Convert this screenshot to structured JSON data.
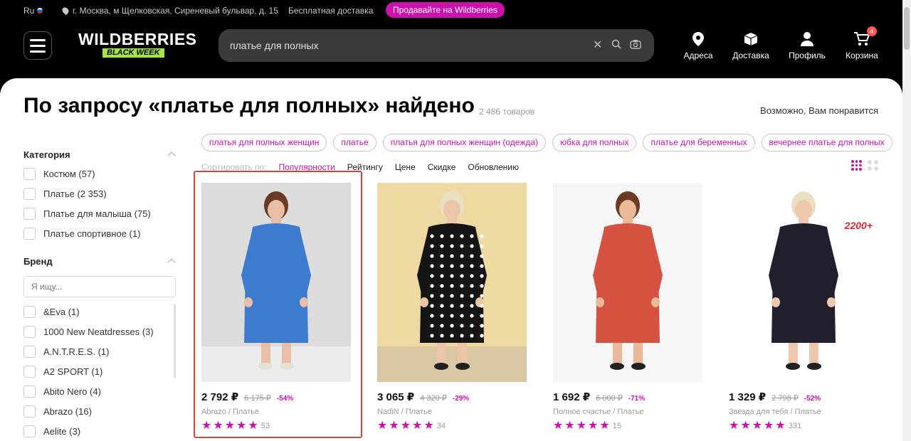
{
  "topbar": {
    "lang": "Ru",
    "address": "г. Москва, м Щелковская, Сиреневый бульвар, д. 15",
    "free_delivery": "Бесплатная доставка",
    "sell_button": "Продавайте на Wildberries"
  },
  "header": {
    "logo_text": "WILDBERRIES",
    "logo_badge": "BLACK WEEK",
    "search_value": "платье для полных",
    "nav": {
      "addresses": "Адреса",
      "delivery": "Доставка",
      "profile": "Профиль",
      "cart": "Корзина",
      "cart_count": "4"
    }
  },
  "results": {
    "title": "По запросу «платье для полных» найдено",
    "count": "2 486 товаров",
    "maybe_like": "Возможно, Вам понравится"
  },
  "sidebar": {
    "category_title": "Категория",
    "categories": [
      "Костюм (57)",
      "Платье (2 353)",
      "Платье для малыша (75)",
      "Платье спортивное (1)"
    ],
    "brand_title": "Бренд",
    "brand_placeholder": "Я ищу...",
    "brands": [
      "&Eva (1)",
      "1000 New Neatdresses (3)",
      "A.N.T.R.E.S. (1)",
      "A2 SPORT (1)",
      "Abito Nero (4)",
      "Abrazo (16)",
      "Aelite (3)"
    ]
  },
  "chips": [
    "платья для полных женщин",
    "платье",
    "платья для полных женщин (одежда)",
    "юбка для полных",
    "платье для беременных",
    "вечернее платье для полных"
  ],
  "sort": {
    "label": "Сортировать по:",
    "options": [
      "Популярности",
      "Рейтингу",
      "Цене",
      "Скидке",
      "Обновлению"
    ],
    "active": "Популярности"
  },
  "products": [
    {
      "price": "2 792 ₽",
      "old_price": "6 175 ₽",
      "discount": "-54%",
      "brand": "Abrazo / Платье",
      "reviews": "53",
      "rating": 5,
      "dress_color": "#3d7bcf",
      "bg": "#dcdcdc",
      "skin": "#e8bfa6"
    },
    {
      "price": "3 065 ₽",
      "old_price": "4 320 ₽",
      "discount": "-29%",
      "brand": "NadiN / Платье",
      "reviews": "34",
      "rating": 5,
      "dress_color": "#151515",
      "bg": "#efd9a2",
      "skin": "#ecc5a9"
    },
    {
      "price": "1 692 ₽",
      "old_price": "6 000 ₽",
      "discount": "-71%",
      "brand": "Полное счастье / Платье",
      "reviews": "15",
      "rating": 5,
      "dress_color": "#d4523f",
      "bg": "#f6f6f6",
      "skin": "#eab99a"
    },
    {
      "price": "1 329 ₽",
      "old_price": "2 798 ₽",
      "discount": "-52%",
      "brand": "Звезда для тебя / Платье",
      "reviews": "331",
      "rating": 5,
      "dress_color": "#1f1f2e",
      "bg": "#ffffff",
      "skin": "#efc7ad",
      "badge": "2200+"
    }
  ],
  "colors": {
    "accent": "#cb11ab",
    "highlight_frame": "#d9443a"
  }
}
